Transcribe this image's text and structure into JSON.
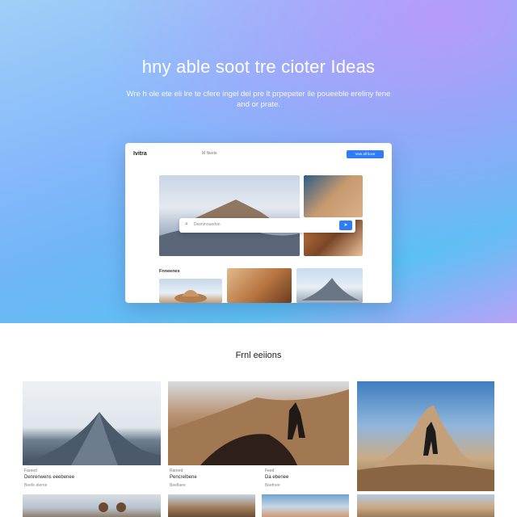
{
  "hero": {
    "title": "hny able soot tre cioter Ideas",
    "subtitle": "Wre h ole ete eli lre te cfere ingel del pre lt prpepeter ile poueeble ereliny fene and or prate."
  },
  "app_preview": {
    "logo": "Ivitra",
    "nav": "M Neele",
    "button_label": "Vew all lioce",
    "search_placeholder": "Desnmouedon",
    "search_button_icon": "search-icon",
    "section_label": "Fnneenes"
  },
  "featured": {
    "title": "Frnl eeiions",
    "cards": [
      {
        "meta": "Fareed",
        "title": "Denrenwens eeebenee",
        "sub": "Beefe elerne"
      },
      {
        "meta": "Rareed",
        "title": "Pencrelbene",
        "sub": "Beeflaee"
      },
      {
        "meta": "Feed",
        "title": "Da ebenee",
        "sub": "Beefnee"
      }
    ]
  },
  "colors": {
    "accent": "#2f7cf6",
    "hero_gradient_start": "#9fd0f7",
    "hero_gradient_end": "#b7a2f7"
  }
}
